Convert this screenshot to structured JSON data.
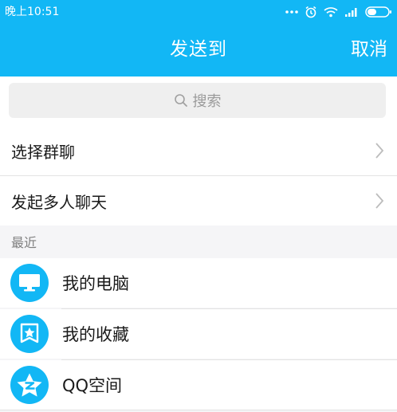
{
  "status_bar": {
    "time": "晚上10:51",
    "icons": [
      "more-dots-icon",
      "alarm-icon",
      "wifi-icon",
      "signal-icon",
      "battery-icon"
    ]
  },
  "header": {
    "title": "发送到",
    "cancel_label": "取消"
  },
  "search": {
    "placeholder": "搜索"
  },
  "options": [
    {
      "label": "选择群聊"
    },
    {
      "label": "发起多人聊天"
    }
  ],
  "recent": {
    "section_label": "最近",
    "items": [
      {
        "label": "我的电脑",
        "icon": "computer-icon"
      },
      {
        "label": "我的收藏",
        "icon": "favorites-icon"
      },
      {
        "label": "QQ空间",
        "icon": "qzone-star-icon"
      }
    ]
  },
  "colors": {
    "brand": "#12b7f5",
    "background": "#f5f5f7",
    "divider": "#e3e3e3"
  }
}
